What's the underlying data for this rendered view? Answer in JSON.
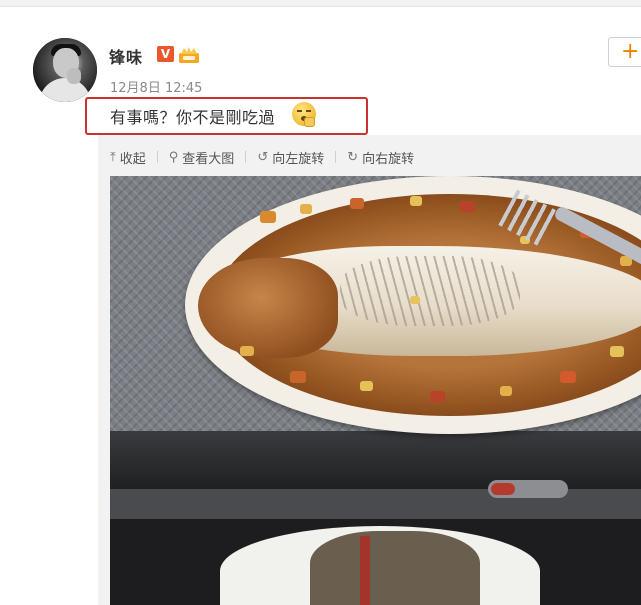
{
  "post": {
    "username": "锋味",
    "verified_badge": "V",
    "timestamp": "12月8日 12:45",
    "text": "有事嗎？你不是剛吃過",
    "emoji": "thinking-face-emoji"
  },
  "follow_button": {
    "label": "+"
  },
  "media_toolbar": {
    "collapse": "收起",
    "view_large": "查看大图",
    "rotate_left": "向左旋转",
    "rotate_right": "向右旋转"
  },
  "colors": {
    "verified_badge": "#e8582a",
    "highlight_box": "#c9332c",
    "follow_plus": "#f08200"
  }
}
